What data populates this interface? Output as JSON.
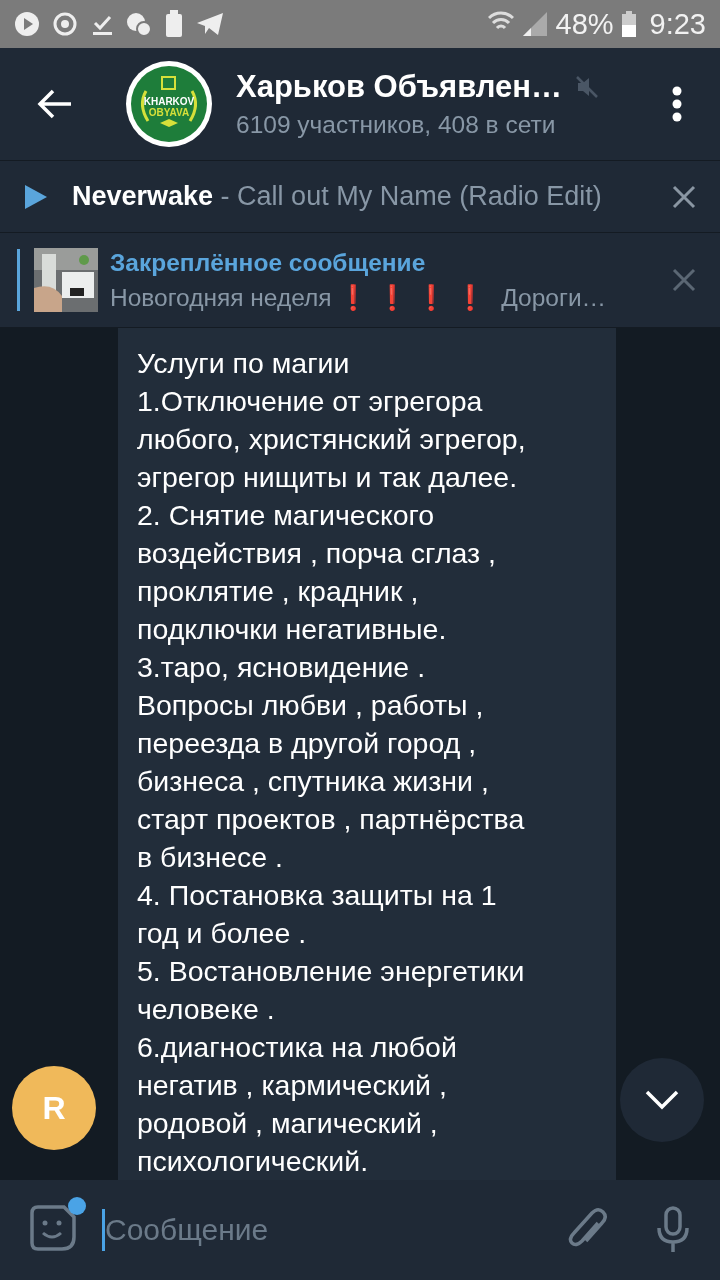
{
  "status_bar": {
    "battery": "48%",
    "time": "9:23"
  },
  "header": {
    "title": "Харьков Объявлен…",
    "subtitle": "6109 участников, 408 в сети",
    "logo": {
      "line1": "KHARKOV",
      "line2": "OBYAVA"
    },
    "muted": true
  },
  "player": {
    "artist": "Neverwake",
    "track": " - Call out My Name (Radio Edit)"
  },
  "pinned": {
    "title": "Закреплённое сообщение",
    "parts": [
      {
        "kind": "plain",
        "text": "Новогодняя неделя "
      },
      {
        "kind": "emoji",
        "text": "❗❗❗❗"
      },
      {
        "kind": "plain",
        "text": " Дороги…"
      }
    ]
  },
  "message": {
    "text": "Услуги по магии\n1.Отключение от эгрегора\nлюбого, христянский эгрегор,\nэгрегор нищиты  и так далее.\n2. Снятие магического\nвоздействия , порча сглаз ,\nпроклятие , крадник ,\nподключки  негативные.\n3.таро, ясновидение .\nВопросы любви , работы ,\nпереезда в другой город ,\nбизнеса , спутника жизни ,\nстарт проектов , партнёрства\nв бизнесе .\n4. Постановка защиты на 1\nгод и более .\n5. Востановление энергетики\nчеловеке .\n6.диагностика на любой\nнегатив , кармический ,\nродовой , магический ,\nпсихологический.",
    "sender": {
      "initial": "R",
      "color": "#f0b95a"
    }
  },
  "composer": {
    "placeholder": "Сообщение",
    "sticker_badge": true
  }
}
